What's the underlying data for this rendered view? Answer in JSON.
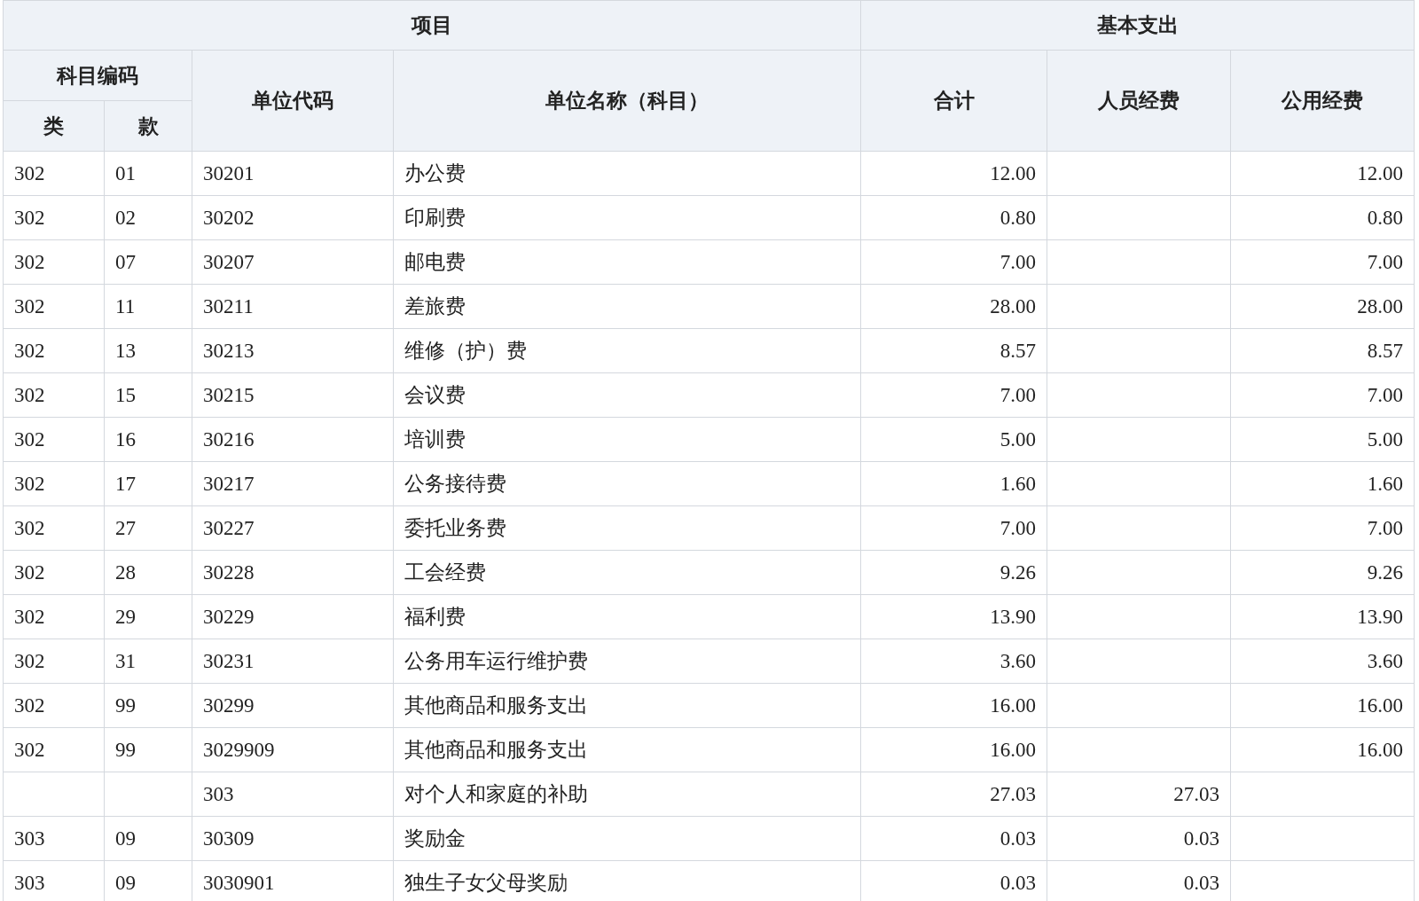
{
  "header": {
    "project": "项目",
    "basic_expense": "基本支出",
    "subject_code": "科目编码",
    "class": "类",
    "item": "款",
    "unit_code": "单位代码",
    "unit_name": "单位名称（科目）",
    "total": "合计",
    "personnel": "人员经费",
    "public": "公用经费"
  },
  "rows": [
    {
      "class": "302",
      "item": "01",
      "unit_code": "30201",
      "unit_name": "办公费",
      "total": "12.00",
      "public": "12.00"
    },
    {
      "class": "302",
      "item": "02",
      "unit_code": "30202",
      "unit_name": "印刷费",
      "total": "0.80",
      "public": "0.80"
    },
    {
      "class": "302",
      "item": "07",
      "unit_code": "30207",
      "unit_name": "邮电费",
      "total": "7.00",
      "public": "7.00"
    },
    {
      "class": "302",
      "item": "11",
      "unit_code": "30211",
      "unit_name": "差旅费",
      "total": "28.00",
      "public": "28.00"
    },
    {
      "class": "302",
      "item": "13",
      "unit_code": "30213",
      "unit_name": "维修（护）费",
      "total": "8.57",
      "public": "8.57"
    },
    {
      "class": "302",
      "item": "15",
      "unit_code": "30215",
      "unit_name": "会议费",
      "total": "7.00",
      "public": "7.00"
    },
    {
      "class": "302",
      "item": "16",
      "unit_code": "30216",
      "unit_name": "培训费",
      "total": "5.00",
      "public": "5.00"
    },
    {
      "class": "302",
      "item": "17",
      "unit_code": "30217",
      "unit_name": "公务接待费",
      "total": "1.60",
      "public": "1.60"
    },
    {
      "class": "302",
      "item": "27",
      "unit_code": "30227",
      "unit_name": "委托业务费",
      "total": "7.00",
      "public": "7.00"
    },
    {
      "class": "302",
      "item": "28",
      "unit_code": "30228",
      "unit_name": "工会经费",
      "total": "9.26",
      "public": "9.26"
    },
    {
      "class": "302",
      "item": "29",
      "unit_code": "30229",
      "unit_name": "福利费",
      "total": "13.90",
      "public": "13.90"
    },
    {
      "class": "302",
      "item": "31",
      "unit_code": "30231",
      "unit_name": "公务用车运行维护费",
      "total": "3.60",
      "public": "3.60"
    },
    {
      "class": "302",
      "item": "99",
      "unit_code": "30299",
      "unit_name": "其他商品和服务支出",
      "total": "16.00",
      "public": "16.00"
    },
    {
      "class": "302",
      "item": "99",
      "unit_code": "3029909",
      "unit_name": "其他商品和服务支出",
      "total": "16.00",
      "public": "16.00"
    },
    {
      "unit_code": "303",
      "unit_name": "对个人和家庭的补助",
      "total": "27.03",
      "personnel": "27.03"
    },
    {
      "class": "303",
      "item": "09",
      "unit_code": "30309",
      "unit_name": "奖励金",
      "total": "0.03",
      "personnel": "0.03"
    },
    {
      "class": "303",
      "item": "09",
      "unit_code": "3030901",
      "unit_name": "独生子女父母奖励",
      "total": "0.03",
      "personnel": "0.03"
    }
  ]
}
